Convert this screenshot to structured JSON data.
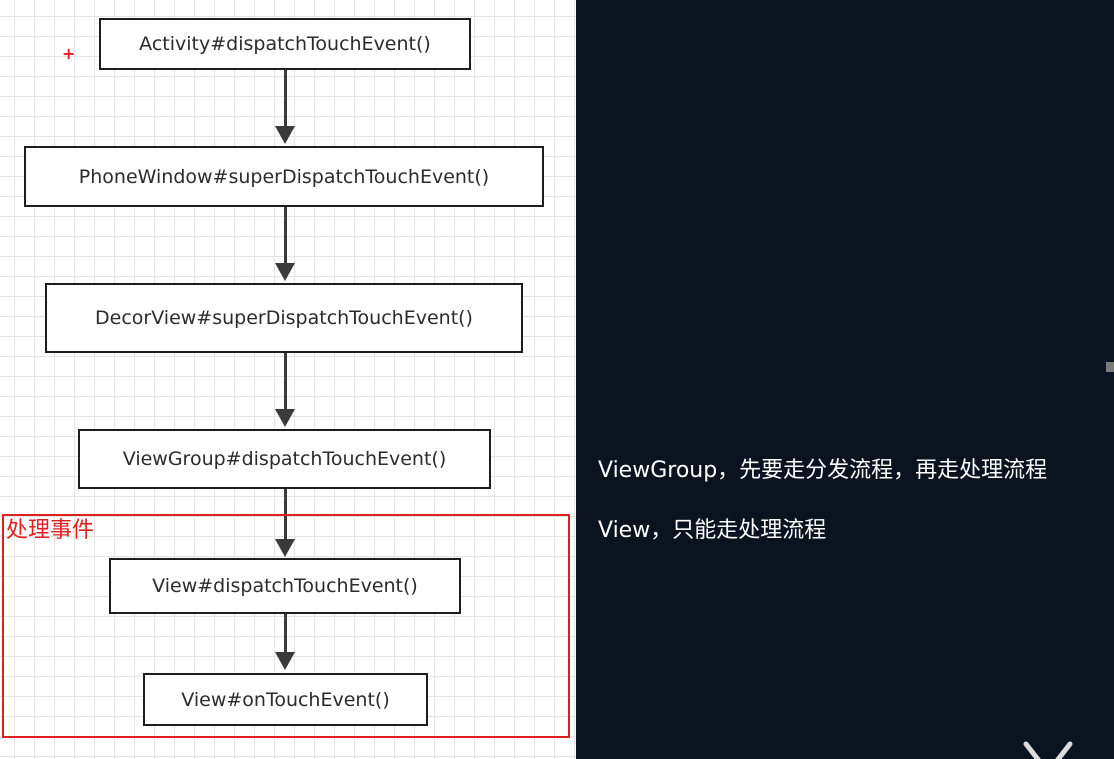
{
  "flow": {
    "nodes": [
      "Activity#dispatchTouchEvent()",
      "PhoneWindow#superDispatchTouchEvent()",
      "DecorView#superDispatchTouchEvent()",
      "ViewGroup#dispatchTouchEvent()",
      "View#dispatchTouchEvent()",
      "View#onTouchEvent()"
    ],
    "region_label": "处理事件",
    "plus_mark": "+"
  },
  "notes": [
    "ViewGroup，先要走分发流程，再走处理流程",
    "View，只能走处理流程"
  ],
  "colors": {
    "page_background": "#0b1220",
    "region_border": "#e02020",
    "node_border": "#1e1e1e",
    "note_text": "#ffffff"
  }
}
